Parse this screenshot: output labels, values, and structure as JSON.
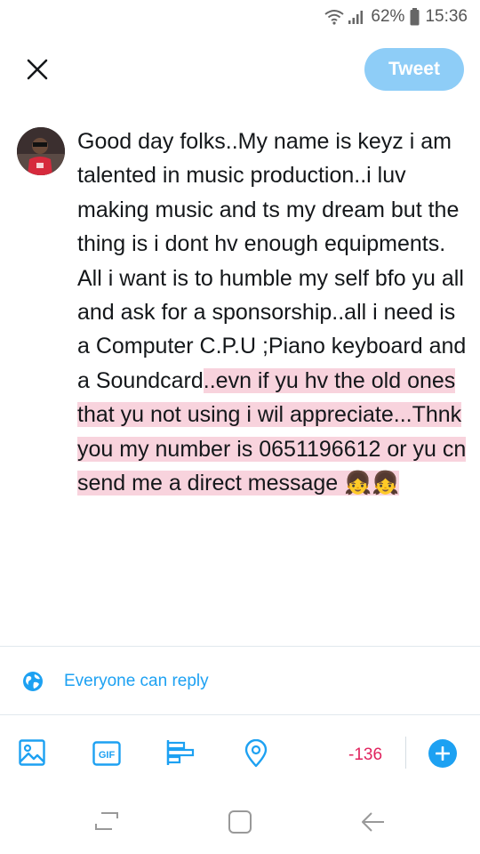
{
  "status_bar": {
    "battery": "62%",
    "time": "15:36"
  },
  "header": {
    "tweet_label": "Tweet"
  },
  "composer": {
    "text_main": "Good day folks..My name is keyz i am talented in music production..i luv making music and ts my dream but the thing is i dont hv enough equipments. All i want is to humble my self bfo yu all and ask for a sponsorship..all i need is a Computer C.P.U ;Piano keyboard and a Soundcard",
    "text_overflow": "..evn if yu hv the old ones that yu not using i wil appreciate...Thnk you my number is 0651196612 or yu cn send me a direct message 👧👧"
  },
  "reply_settings": {
    "label": "Everyone can reply"
  },
  "toolbar": {
    "gif_label": "GIF",
    "char_counter": "-136"
  },
  "colors": {
    "accent": "#1da1f2",
    "tweet_button_disabled": "#8ecdf7",
    "overflow_highlight": "#f8d3dd",
    "counter_over": "#e0245e"
  }
}
